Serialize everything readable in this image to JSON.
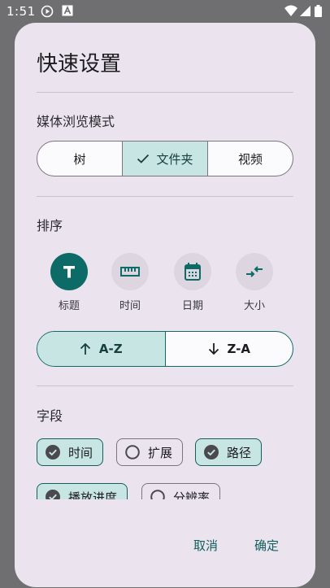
{
  "status_bar": {
    "time": "1:51"
  },
  "dialog": {
    "title": "快速设置",
    "browse_mode": {
      "label": "媒体浏览模式",
      "options": [
        "树",
        "文件夹",
        "视频"
      ],
      "selected": "文件夹"
    },
    "sort": {
      "label": "排序",
      "items": [
        {
          "label": "标题",
          "icon": "title-t-icon",
          "selected": true
        },
        {
          "label": "时间",
          "icon": "ruler-icon",
          "selected": false
        },
        {
          "label": "日期",
          "icon": "calendar-icon",
          "selected": false
        },
        {
          "label": "大小",
          "icon": "compress-icon",
          "selected": false
        }
      ],
      "direction": {
        "asc": "A-Z",
        "desc": "Z-A",
        "selected": "A-Z"
      }
    },
    "fields": {
      "label": "字段",
      "chips": [
        {
          "label": "时间",
          "checked": true
        },
        {
          "label": "扩展",
          "checked": false
        },
        {
          "label": "路径",
          "checked": true
        },
        {
          "label": "播放进度",
          "checked": true
        },
        {
          "label": "分辨率",
          "checked": false
        }
      ]
    },
    "actions": {
      "cancel": "取消",
      "confirm": "确定"
    }
  },
  "colors": {
    "accent": "#0c6b66",
    "selected_fill": "#c7e5e3",
    "dialog_bg": "#ebe4ef"
  }
}
